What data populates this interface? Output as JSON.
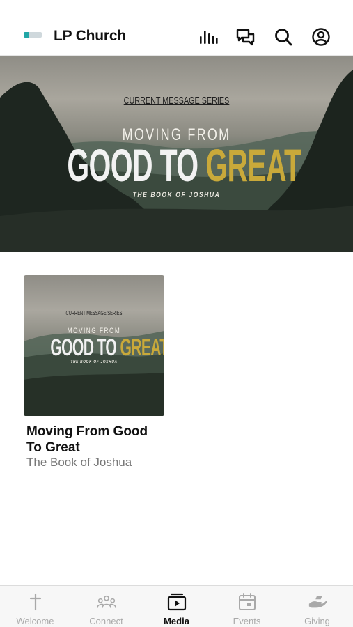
{
  "header": {
    "title": "LP Church",
    "icons": [
      "logo-icon",
      "audio-bars-icon",
      "chat-icon",
      "search-icon",
      "profile-icon"
    ]
  },
  "hero": {
    "tag": "CURRENT MESSAGE SERIES",
    "subtitle": "MOVING FROM",
    "main_white": "GOOD TO ",
    "main_gold": "GREAT",
    "book": "THE BOOK OF JOSHUA"
  },
  "card": {
    "art": {
      "tag": "CURRENT MESSAGE SERIES",
      "subtitle": "MOVING FROM",
      "main_white": "GOOD TO ",
      "main_gold": "GREAT",
      "book": "THE BOOK OF JOSHUA"
    },
    "title": "Moving From Good To Great",
    "subtitle": "The Book of Joshua"
  },
  "tabbar": {
    "active": "Media",
    "tabs": [
      {
        "label": "Welcome",
        "icon": "cross-icon"
      },
      {
        "label": "Connect",
        "icon": "people-icon"
      },
      {
        "label": "Media",
        "icon": "media-play-icon"
      },
      {
        "label": "Events",
        "icon": "calendar-icon"
      },
      {
        "label": "Giving",
        "icon": "giving-hand-icon"
      }
    ]
  },
  "colors": {
    "accent_gold": "#c9a93a",
    "tab_inactive": "#a9a9a9",
    "tab_active": "#111111"
  }
}
